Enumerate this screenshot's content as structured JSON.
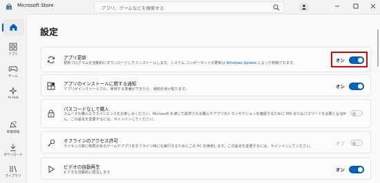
{
  "app": {
    "name": "Microsoft Store",
    "search_placeholder": "アプリ、ゲームなどを検索する"
  },
  "sidebar": {
    "items": [
      {
        "label": "",
        "icon": "home-icon"
      },
      {
        "label": "アプリ",
        "icon": "apps-icon"
      },
      {
        "label": "ゲーム",
        "icon": "gamepad-icon"
      },
      {
        "label": "AI Hub",
        "icon": "ai-hub-icon"
      },
      {
        "label": "新着情報",
        "icon": "whats-new-icon"
      },
      {
        "label": "ダウンロード",
        "icon": "download-icon"
      },
      {
        "label": "ライブラリ",
        "icon": "library-icon"
      }
    ]
  },
  "page": {
    "title": "設定"
  },
  "settings": [
    {
      "title": "アプリ更新",
      "desc_before": "更新プログラムを自動的にダウンロードしてインストールします。システム コンポーネントの更新は ",
      "desc_link": "Windows Update",
      "desc_after": " によって制御されます。",
      "state": "オン",
      "enabled": true
    },
    {
      "title": "アプリのインストールに関する通知",
      "desc": "アプリがインストールされ、使用する準備ができたら、通知を受け取ります。",
      "state": "オン",
      "enabled": true
    },
    {
      "title": "パスコードなしで購入",
      "desc": "スムーズな購入エクスペリエンスをお楽しみください。Microsoft を通じて請求される購入やアプリ内トランザクションを確認するために PIN またはパスワードを必要としません。この設定を変更するには、サインインしてください。",
      "state": "オフ",
      "enabled": false
    },
    {
      "title": "オフラインのアクセス許可",
      "desc": "ライセンス数に制限があるゲームやアプリをオフライン時にも実行するためにこの PC を使用します。この設定を変更するには、サインインしてください。",
      "state": "オフ",
      "enabled": false
    },
    {
      "title": "ビデオの自動再生",
      "desc": "ビデオを自動的に再生します",
      "state": "オン",
      "enabled": true
    }
  ],
  "colors": {
    "accent": "#005fb8",
    "highlight": "#d90000",
    "link": "#0067c0"
  }
}
